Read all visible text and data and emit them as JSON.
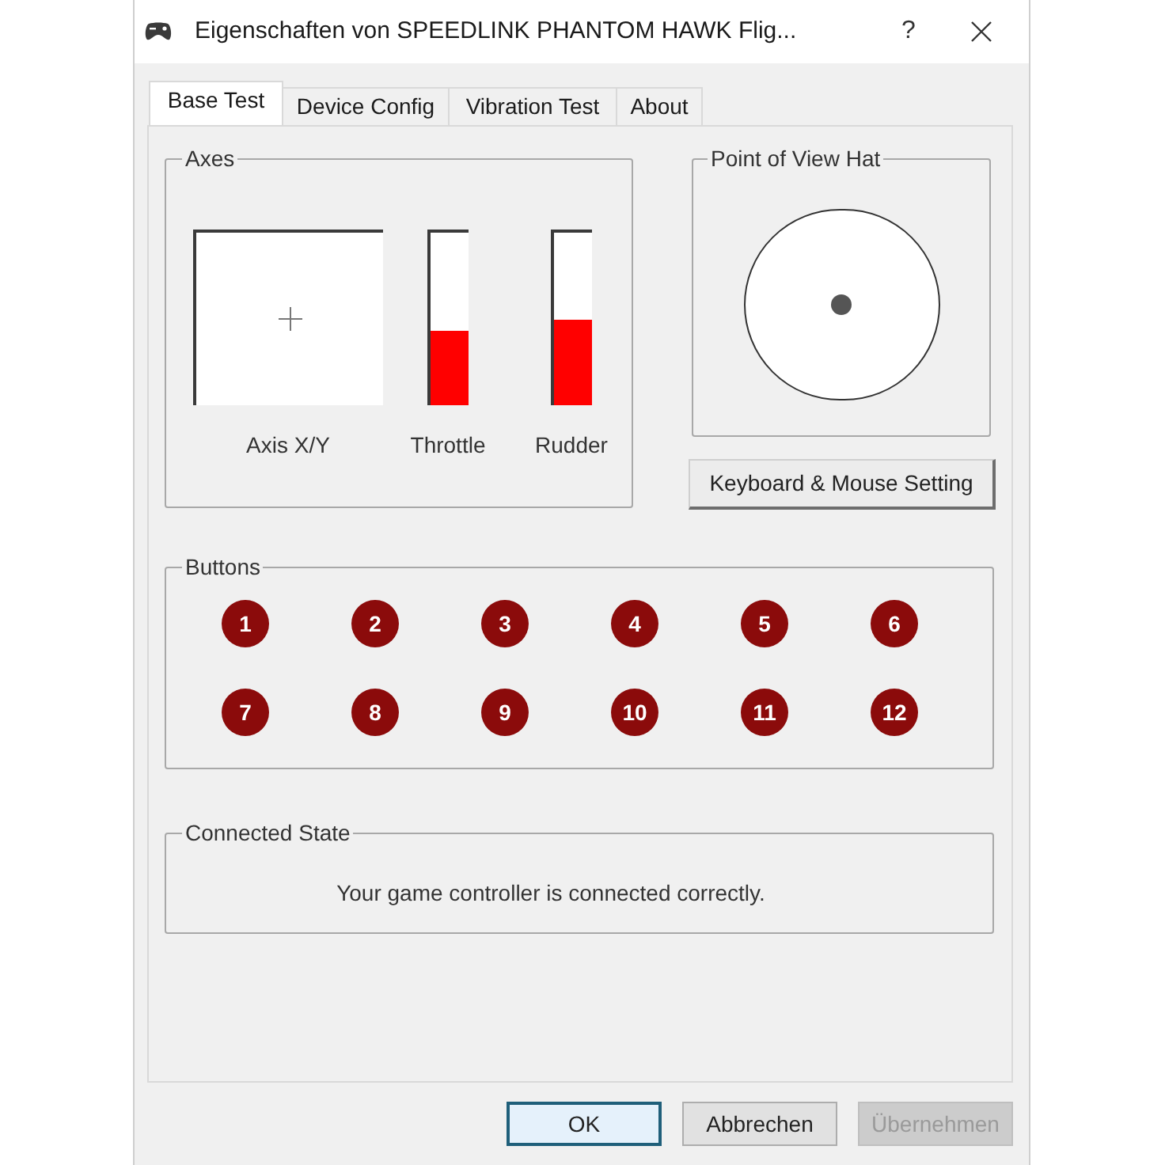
{
  "window": {
    "title": "Eigenschaften von SPEEDLINK PHANTOM HAWK Flig...",
    "help_button": "?"
  },
  "tabs": [
    {
      "label": "Base Test",
      "selected": true
    },
    {
      "label": "Device Config",
      "selected": false
    },
    {
      "label": "Vibration Test",
      "selected": false
    },
    {
      "label": "About",
      "selected": false
    }
  ],
  "axes": {
    "title": "Axes",
    "xy_label": "Axis X/Y",
    "bars": [
      {
        "label": "Throttle",
        "level": 0.43
      },
      {
        "label": "Rudder",
        "level": 0.5
      }
    ]
  },
  "pov_hat": {
    "title": "Point of View Hat"
  },
  "keyboard_mouse_button": "Keyboard & Mouse Setting",
  "buttons_group": {
    "title": "Buttons",
    "buttons": [
      "1",
      "2",
      "3",
      "4",
      "5",
      "6",
      "7",
      "8",
      "9",
      "10",
      "11",
      "12"
    ]
  },
  "connected_state": {
    "title": "Connected State",
    "message": "Your game controller is connected correctly."
  },
  "dialog_buttons": [
    {
      "label": "OK",
      "default": true,
      "disabled": false
    },
    {
      "label": "Abbrechen",
      "default": false,
      "disabled": false
    },
    {
      "label": "Übernehmen",
      "default": false,
      "disabled": true
    }
  ]
}
